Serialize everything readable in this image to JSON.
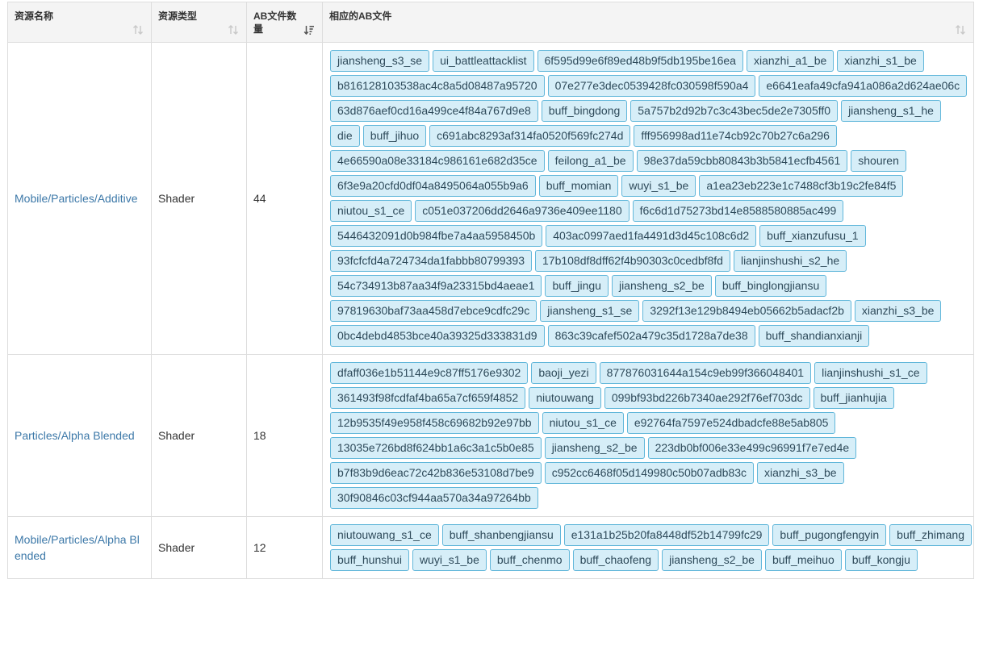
{
  "headers": {
    "name": "资源名称",
    "type": "资源类型",
    "count": "AB文件数量",
    "files": "相应的AB文件"
  },
  "rows": [
    {
      "name": "Mobile/Particles/Additive",
      "type": "Shader",
      "count": "44",
      "files": [
        "jiansheng_s3_se",
        "ui_battleattacklist",
        "6f595d99e6f89ed48b9f5db195be16ea",
        "xianzhi_a1_be",
        "xianzhi_s1_be",
        "b816128103538ac4c8a5d08487a95720",
        "07e277e3dec0539428fc030598f590a4",
        "e6641eafa49cfa941a086a2d624ae06c",
        "63d876aef0cd16a499ce4f84a767d9e8",
        "buff_bingdong",
        "5a757b2d92b7c3c43bec5de2e7305ff0",
        "jiansheng_s1_he",
        "die",
        "buff_jihuo",
        "c691abc8293af314fa0520f569fc274d",
        "fff956998ad11e74cb92c70b27c6a296",
        "4e66590a08e33184c986161e682d35ce",
        "feilong_a1_be",
        "98e37da59cbb80843b3b5841ecfb4561",
        "shouren",
        "6f3e9a20cfd0df04a8495064a055b9a6",
        "buff_momian",
        "wuyi_s1_be",
        "a1ea23eb223e1c7488cf3b19c2fe84f5",
        "niutou_s1_ce",
        "c051e037206dd2646a9736e409ee1180",
        "f6c6d1d75273bd14e8588580885ac499",
        "5446432091d0b984fbe7a4aa5958450b",
        "403ac0997aed1fa4491d3d45c108c6d2",
        "buff_xianzufusu_1",
        "93fcfcfd4a724734da1fabbb80799393",
        "17b108df8dff62f4b90303c0cedbf8fd",
        "lianjinshushi_s2_he",
        "54c734913b87aa34f9a23315bd4aeae1",
        "buff_jingu",
        "jiansheng_s2_be",
        "buff_binglongjiansu",
        "97819630baf73aa458d7ebce9cdfc29c",
        "jiansheng_s1_se",
        "3292f13e129b8494eb05662b5adacf2b",
        "xianzhi_s3_be",
        "0bc4debd4853bce40a39325d333831d9",
        "863c39cafef502a479c35d1728a7de38",
        "buff_shandianxianji"
      ]
    },
    {
      "name": "Particles/Alpha Blended",
      "type": "Shader",
      "count": "18",
      "files": [
        "dfaff036e1b51144e9c87ff5176e9302",
        "baoji_yezi",
        "877876031644a154c9eb99f366048401",
        "lianjinshushi_s1_ce",
        "361493f98fcdfaf4ba65a7cf659f4852",
        "niutouwang",
        "099bf93bd226b7340ae292f76ef703dc",
        "buff_jianhujia",
        "12b9535f49e958f458c69682b92e97bb",
        "niutou_s1_ce",
        "e92764fa7597e524dbadcfe88e5ab805",
        "13035e726bd8f624bb1a6c3a1c5b0e85",
        "jiansheng_s2_be",
        "223db0bf006e33e499c96991f7e7ed4e",
        "b7f83b9d6eac72c42b836e53108d7be9",
        "c952cc6468f05d149980c50b07adb83c",
        "xianzhi_s3_be",
        "30f90846c03cf944aa570a34a97264bb"
      ]
    },
    {
      "name": "Mobile/Particles/Alpha Bl ended",
      "type": "Shader",
      "count": "12",
      "files": [
        "niutouwang_s1_ce",
        "buff_shanbengjiansu",
        "e131a1b25b20fa8448df52b14799fc29",
        "buff_pugongfengyin",
        "buff_zhimang",
        "buff_hunshui",
        "wuyi_s1_be",
        "buff_chenmo",
        "buff_chaofeng",
        "jiansheng_s2_be",
        "buff_meihuo",
        "buff_kongju"
      ]
    }
  ]
}
